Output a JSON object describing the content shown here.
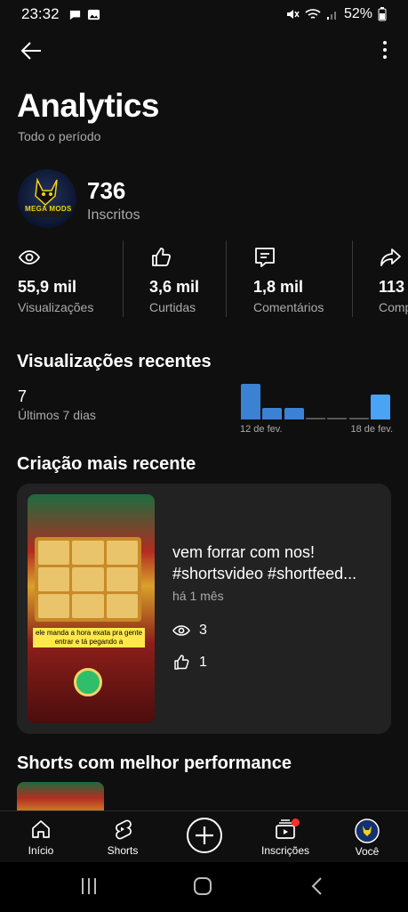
{
  "status_bar": {
    "time": "23:32",
    "battery": "52%"
  },
  "header": {
    "title": "Analytics",
    "period": "Todo o período"
  },
  "channel": {
    "subscribers": "736",
    "subscribers_label": "Inscritos",
    "avatar_text": "MEGA MODS"
  },
  "stats": [
    {
      "value": "55,9 mil",
      "label": "Visualizações",
      "icon": "eye-icon"
    },
    {
      "value": "3,6 mil",
      "label": "Curtidas",
      "icon": "thumbs-up-icon"
    },
    {
      "value": "1,8 mil",
      "label": "Comentários",
      "icon": "comment-icon"
    },
    {
      "value": "113",
      "label": "Compartilhamentos",
      "icon": "share-icon"
    }
  ],
  "recent_views": {
    "title": "Visualizações recentes",
    "value": "7",
    "label": "Últimos 7 dias",
    "chart_data": {
      "type": "bar",
      "categories": [
        "12 de fev.",
        "13 de fev.",
        "14 de fev.",
        "15 de fev.",
        "16 de fev.",
        "17 de fev.",
        "18 de fev."
      ],
      "values": [
        3.3,
        1.1,
        1.1,
        0,
        0,
        0,
        2.3
      ],
      "tick_labels": [
        "12 de fev.",
        "18 de fev."
      ],
      "highlight_last": true
    }
  },
  "latest": {
    "section_title": "Criação mais recente",
    "title_line1": "vem forrar com nos!",
    "title_line2": "#shortsvideo #shortfeed...",
    "time": "há 1 mês",
    "views": "3",
    "likes": "1",
    "thumbnail_caption": "ele manda a hora exata pra gente entrar e tá pegando a"
  },
  "shorts_section": {
    "title": "Shorts com melhor performance"
  },
  "bottom_nav": [
    {
      "label": "Início",
      "icon": "home-icon"
    },
    {
      "label": "Shorts",
      "icon": "shorts-icon"
    },
    {
      "label": "",
      "icon": "create-icon"
    },
    {
      "label": "Inscrições",
      "icon": "subscriptions-icon"
    },
    {
      "label": "Você",
      "icon": "you-avatar-icon"
    }
  ],
  "colors": {
    "background": "#0f0f0f",
    "accent_bar": "#3b82d3",
    "accent_bar_highlight": "#4aa3f5",
    "notification": "#ff2d2d"
  }
}
